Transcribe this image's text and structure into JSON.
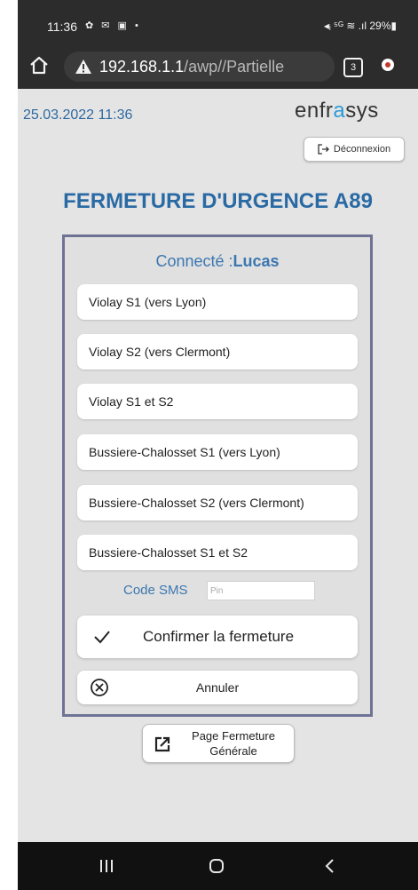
{
  "status_bar": {
    "time": "11:36",
    "left_icons": "✿ ✉ ▣ •",
    "right_text": "◂ᵢ ⁵ᴳ ≋ .ıl 29%▮"
  },
  "browser": {
    "url_host": "192.168.1.1",
    "url_path": "/awp//Partielle",
    "tab_count": "3"
  },
  "header": {
    "datetime": "25.03.2022 11:36",
    "brand_part1": "enfr",
    "brand_accent": "a",
    "brand_part2": "sys",
    "logout_label": "Déconnexion"
  },
  "page": {
    "title": "FERMETURE D'URGENCE A89"
  },
  "panel": {
    "connected_label": "Connecté :",
    "connected_user": "Lucas",
    "options": [
      {
        "label": "Violay S1 (vers Lyon)"
      },
      {
        "label": "Violay S2 (vers Clermont)"
      },
      {
        "label": "Violay S1 et S2"
      },
      {
        "label": "Bussiere-Chalosset S1 (vers Lyon)"
      },
      {
        "label": "Bussiere-Chalosset S2 (vers Clermont)"
      },
      {
        "label": "Bussiere-Chalosset S1 et S2"
      }
    ],
    "sms_label": "Code SMS",
    "sms_placeholder": "Pin",
    "confirm_label": "Confirmer la fermeture",
    "cancel_label": "Annuler"
  },
  "footer_button": {
    "line1": "Page Fermeture",
    "line2": "Générale"
  },
  "colors": {
    "title_blue": "#2a6aa4",
    "panel_border": "#6e7396",
    "brand_accent": "#2b9bd6"
  }
}
